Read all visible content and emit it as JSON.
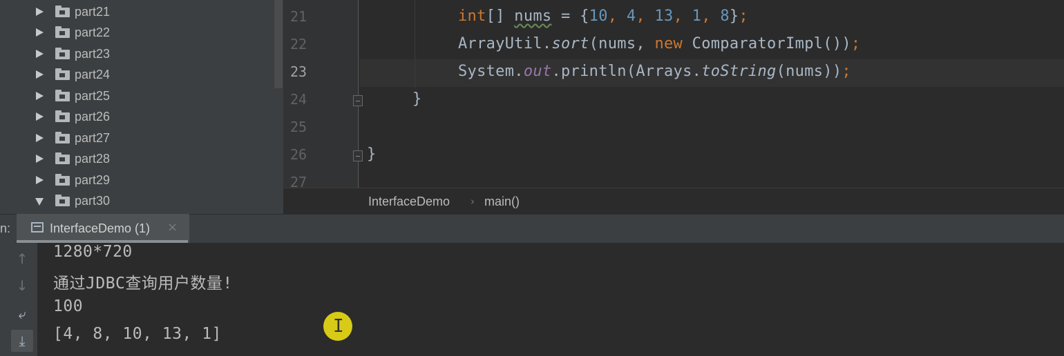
{
  "project_tree": {
    "items": [
      {
        "label": "part21",
        "expanded": false
      },
      {
        "label": "part22",
        "expanded": false
      },
      {
        "label": "part23",
        "expanded": false
      },
      {
        "label": "part24",
        "expanded": false
      },
      {
        "label": "part25",
        "expanded": false
      },
      {
        "label": "part26",
        "expanded": false
      },
      {
        "label": "part27",
        "expanded": false
      },
      {
        "label": "part28",
        "expanded": false
      },
      {
        "label": "part29",
        "expanded": false
      },
      {
        "label": "part30",
        "expanded": true
      }
    ]
  },
  "editor": {
    "line_numbers": [
      "21",
      "22",
      "23",
      "24",
      "25",
      "26",
      "27"
    ],
    "current_line": "23",
    "code": {
      "l21": {
        "kw": "int",
        "br": "[] ",
        "var": "nums",
        "eq": " = {",
        "n1": "10",
        "c1": ", ",
        "n2": "4",
        "c2": ", ",
        "n3": "13",
        "c3": ", ",
        "n4": "1",
        "c4": ", ",
        "n5": "8",
        "end": "}",
        "semi": ";"
      },
      "l22": {
        "cls": "ArrayUtil.",
        "method": "sort",
        "open": "(nums, ",
        "kw": "new",
        "rest": " ComparatorImpl())",
        "semi": ";"
      },
      "l23": {
        "cls": "System.",
        "field": "out",
        "mid": ".println(Arrays.",
        "method": "toString",
        "rest": "(nums))",
        "semi": ";"
      },
      "l24": "}",
      "l26": "}"
    },
    "breadcrumb": [
      "InterfaceDemo",
      "main()"
    ]
  },
  "run_panel": {
    "label": "n:",
    "tab_title": "InterfaceDemo (1)",
    "close_glyph": "×",
    "side_icons": [
      "↑",
      "↓",
      "⤶",
      "⤓"
    ],
    "output_lines": [
      "1280*720",
      "通过JDBC查询用户数量!",
      "100",
      "[4, 8, 10, 13, 1]"
    ],
    "cursor_glyph": "I"
  },
  "colors": {
    "keyword": "#cc7832",
    "number": "#6897bb",
    "field": "#9876aa",
    "text": "#a9b7c6",
    "cursor_highlight": "#d7cb17"
  }
}
